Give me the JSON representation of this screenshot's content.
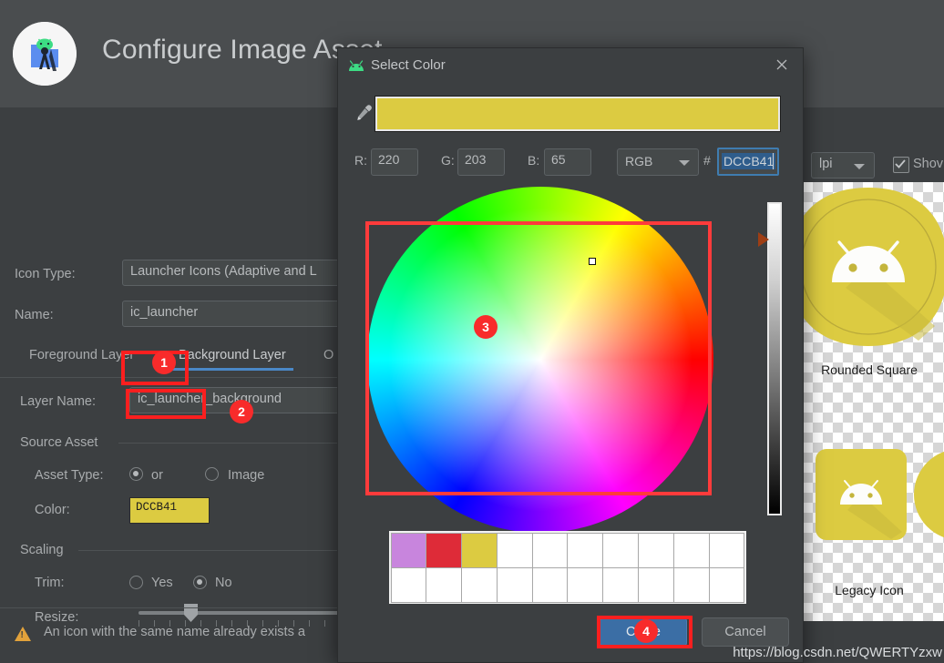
{
  "wizard": {
    "title": "Configure Image Asset",
    "logo_icon": "android-studio-image-asset-icon",
    "fields": {
      "icon_type_label": "Icon Type:",
      "icon_type_value": "Launcher Icons (Adaptive and L",
      "name_label": "Name:",
      "name_value": "ic_launcher",
      "layer_name_label": "Layer Name:",
      "layer_name_value": "ic_launcher_background"
    },
    "tabs": [
      {
        "label": "Foreground Layer",
        "active": false
      },
      {
        "label": "Background Layer",
        "active": true
      },
      {
        "label": "O",
        "active": false
      }
    ],
    "source_asset": {
      "section_label": "Source Asset",
      "asset_type_label": "Asset Type:",
      "asset_type_color": "or",
      "asset_type_image": "Image",
      "color_label": "Color:",
      "color_value": "DCCB41"
    },
    "scaling": {
      "section_label": "Scaling",
      "trim_label": "Trim:",
      "trim_yes": "Yes",
      "trim_no": "No",
      "resize_label": "Resize:"
    },
    "warning": {
      "icon": "warning-triangle-icon",
      "text": "An icon with the same name already exists a"
    },
    "preview": {
      "dpi_value": "lpi",
      "show_label": "Shov",
      "rounded_square_label": "Rounded Square",
      "legacy_icon_label": "Legacy Icon"
    }
  },
  "dialog": {
    "icon": "android-head-icon",
    "title": "Select Color",
    "close_icon": "close-icon",
    "eyedropper_icon": "eyedropper-icon",
    "preview_color": "#DCCB41",
    "channels": [
      {
        "label": "R:",
        "value": "220"
      },
      {
        "label": "G:",
        "value": "203"
      },
      {
        "label": "B:",
        "value": "65"
      }
    ],
    "mode": "RGB",
    "mode_caret_icon": "chevron-down-icon",
    "hash": "#",
    "hex_value": "DCCB41",
    "wheel_name": "color-wheel",
    "brightness_slider_name": "brightness-slider",
    "palette_swatches": [
      "#c885dd",
      "#de2b38",
      "#dccb41",
      "",
      "",
      "",
      "",
      "",
      "",
      "",
      "",
      "",
      "",
      "",
      "",
      "",
      "",
      "",
      "",
      ""
    ],
    "buttons": {
      "choose": "C           ose",
      "cancel": "Cancel"
    }
  },
  "annotations": {
    "badges": [
      {
        "n": "1",
        "target": "asset-type-color-radio"
      },
      {
        "n": "2",
        "target": "color-field"
      },
      {
        "n": "3",
        "target": "color-wheel"
      },
      {
        "n": "4",
        "target": "choose-button"
      }
    ],
    "highlight_color": "#FB1F1F"
  },
  "watermark": "https://blog.csdn.net/QWERTYzxw"
}
